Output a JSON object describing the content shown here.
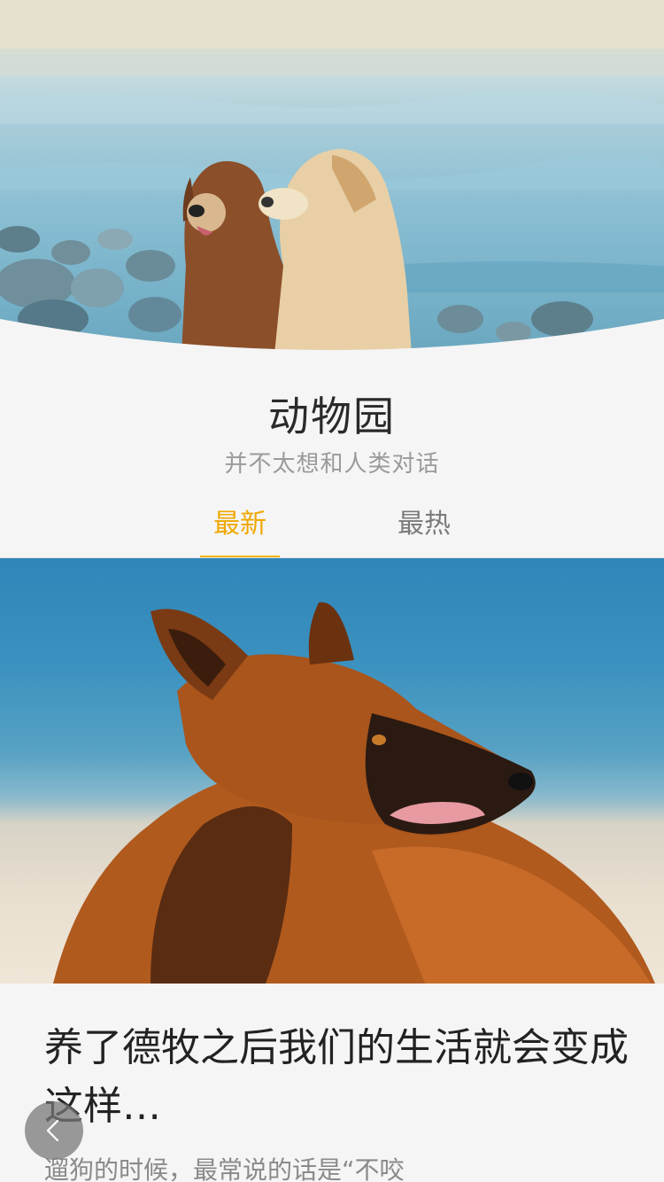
{
  "hero": {
    "image": "two-golden-retrievers-on-beach"
  },
  "channel": {
    "title": "动物园",
    "subtitle": "并不太想和人类对话"
  },
  "tabs": [
    {
      "label": "最新",
      "active": true
    },
    {
      "label": "最热",
      "active": false
    }
  ],
  "colors": {
    "accent": "#f0a800",
    "background": "#f5f5f5"
  },
  "article": {
    "image": "german-shepherd-on-beach",
    "title": "养了德牧之后我们的生活就会变成这样…",
    "excerpt": "遛狗的时候，最常说的话是“不咬"
  },
  "floating": {
    "back_icon": "chevron-left-icon"
  }
}
